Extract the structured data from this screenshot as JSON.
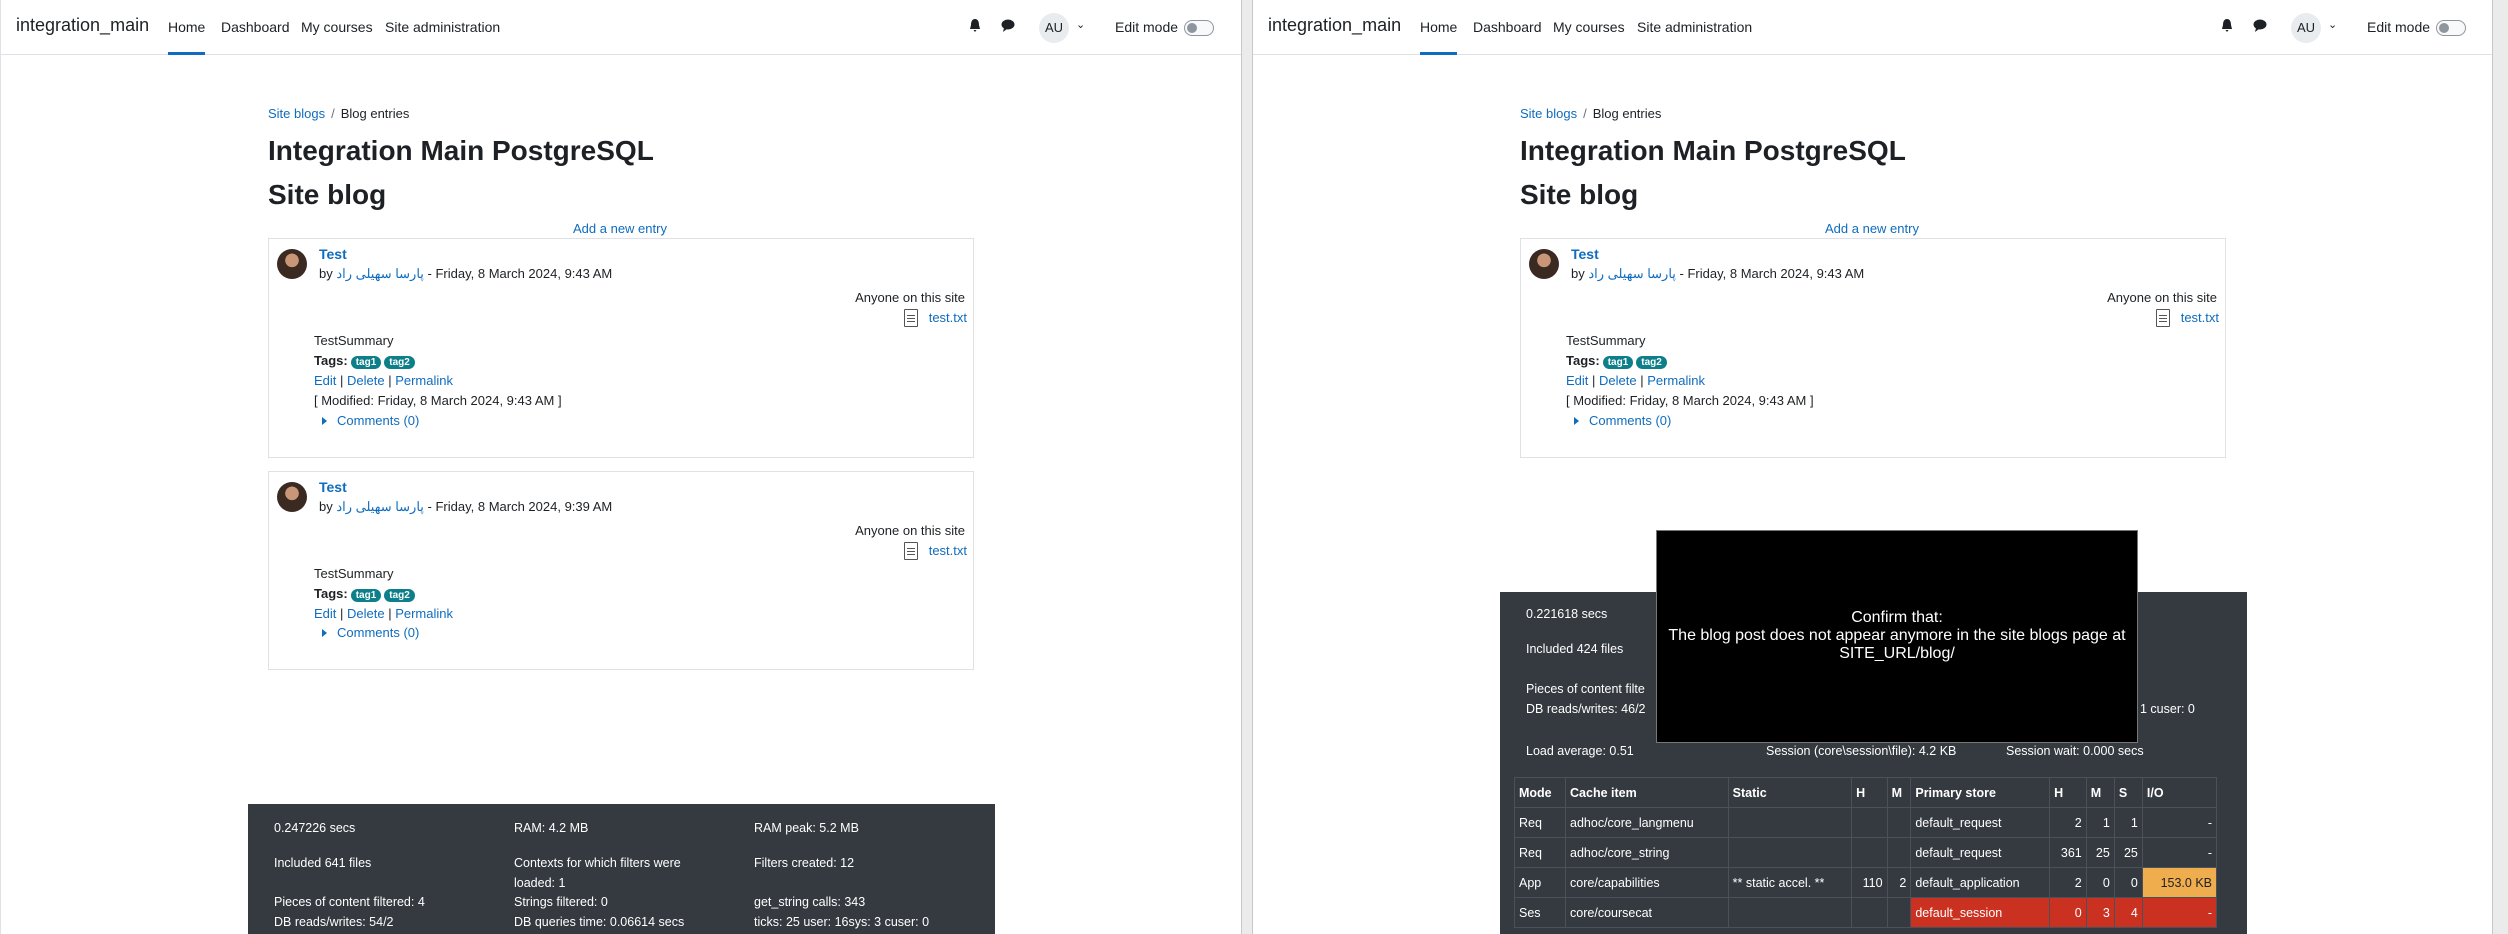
{
  "nav": {
    "site_name": "integration_main",
    "items": [
      "Home",
      "Dashboard",
      "My courses",
      "Site administration"
    ],
    "avatar_initials": "AU",
    "edit_mode_label": "Edit mode"
  },
  "breadcrumb": {
    "first": "Site blogs",
    "second": "Blog entries"
  },
  "page": {
    "title": "Integration Main PostgreSQL",
    "subtitle": "Site blog",
    "add_entry": "Add a new entry"
  },
  "entries": [
    {
      "title": "Test",
      "by": "by",
      "author": "پارسا سهیلی راد",
      "date": " - Friday, 8 March 2024, 9:43 AM",
      "audience": "Anyone on this site",
      "file": "test.txt",
      "summary": "TestSummary",
      "tags_label": "Tags:",
      "tags": [
        "tag1",
        "tag2"
      ],
      "edit": "Edit",
      "delete": "Delete",
      "permalink": "Permalink",
      "modified": "[ Modified: Friday, 8 March 2024, 9:43 AM ]",
      "comments": "Comments (0)"
    },
    {
      "title": "Test",
      "by": "by",
      "author": "پارسا سهیلی راد",
      "date": " - Friday, 8 March 2024, 9:39 AM",
      "audience": "Anyone on this site",
      "file": "test.txt",
      "summary": "TestSummary",
      "tags_label": "Tags:",
      "tags": [
        "tag1",
        "tag2"
      ],
      "edit": "Edit",
      "delete": "Delete",
      "permalink": "Permalink",
      "comments": "Comments (0)"
    }
  ],
  "perf_left": {
    "secs": "0.247226 secs",
    "files": "Included 641 files",
    "filtered": "Pieces of content filtered: 4",
    "dbrw": "DB reads/writes: 54/2",
    "ram": "RAM: 4.2 MB",
    "contexts": "Contexts for which filters were loaded: 1",
    "strings": "Strings filtered: 0",
    "dbtime": "DB queries time: 0.06614 secs",
    "rampeak": "RAM peak: 5.2 MB",
    "filters": "Filters created: 12",
    "getstring": "get_string calls: 343",
    "ticks": "ticks: 25 user: 16sys: 3 cuser: 0"
  },
  "perf_right": {
    "secs": "0.221618 secs",
    "files": "Included 424 files",
    "filtered": "Pieces of content filte",
    "dbrw": "DB reads/writes: 46/2",
    "cuser": "1 cuser: 0",
    "load": "Load average: 0.51",
    "session": "Session (core\\session\\file): 4.2 KB",
    "sessionwait": "Session wait: 0.000 secs"
  },
  "cache_table": {
    "headers": [
      "Mode",
      "Cache item",
      "Static",
      "H",
      "M",
      "Primary store",
      "H",
      "M",
      "S",
      "I/O"
    ],
    "rows": [
      [
        "Req",
        "adhoc/core_langmenu",
        "",
        "",
        "",
        "default_request",
        "2",
        "1",
        "1",
        "-"
      ],
      [
        "Req",
        "adhoc/core_string",
        "",
        "",
        "",
        "default_request",
        "361",
        "25",
        "25",
        "-"
      ],
      [
        "App",
        "core/capabilities",
        "** static accel. **",
        "110",
        "2",
        "default_application",
        "2",
        "0",
        "0",
        "153.0 KB"
      ],
      [
        "Ses",
        "core/coursecat",
        "",
        "",
        "",
        "default_session",
        "0",
        "3",
        "4",
        "-"
      ]
    ]
  },
  "overlay": {
    "heading": "Confirm that:",
    "body": "The blog post does not appear anymore in the site blogs page at SITE_URL/blog/"
  }
}
